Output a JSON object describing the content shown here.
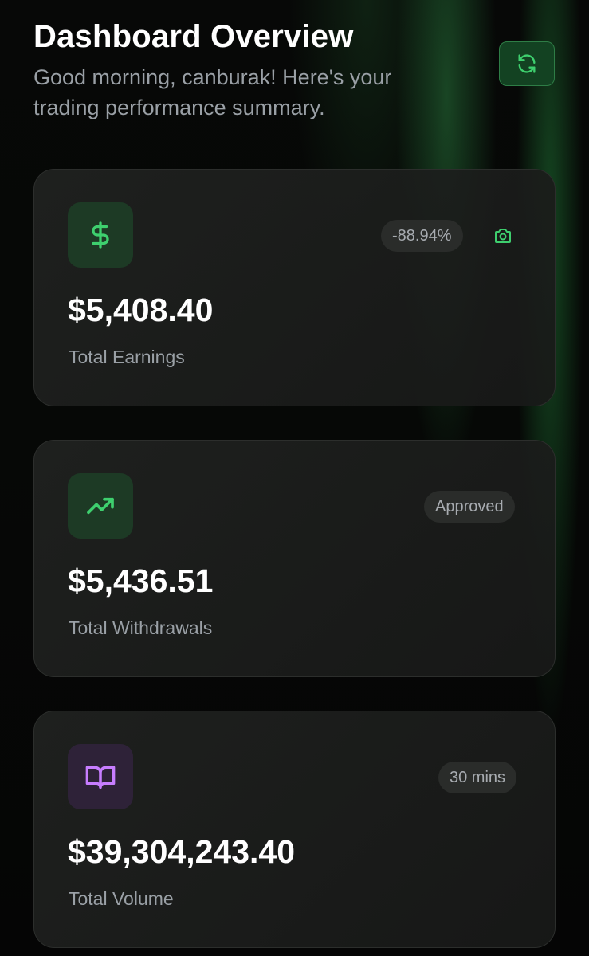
{
  "header": {
    "title": "Dashboard Overview",
    "subtitle": "Good morning, canburak! Here's your trading performance summary.",
    "refresh_icon": "refresh-icon"
  },
  "cards": [
    {
      "icon": "dollar-icon",
      "badge": "-88.94%",
      "action_icon": "camera-icon",
      "value": "$5,408.40",
      "label": "Total Earnings"
    },
    {
      "icon": "trending-up-icon",
      "badge": "Approved",
      "value": "$5,436.51",
      "label": "Total Withdrawals"
    },
    {
      "icon": "book-icon",
      "badge": "30 mins",
      "value": "$39,304,243.40",
      "label": "Total Volume"
    }
  ],
  "colors": {
    "accent_green": "#3ecf6e",
    "accent_purple": "#c77dff",
    "background": "#050505",
    "card_background": "#1c1d1c",
    "muted_text": "#9aa0a6"
  }
}
